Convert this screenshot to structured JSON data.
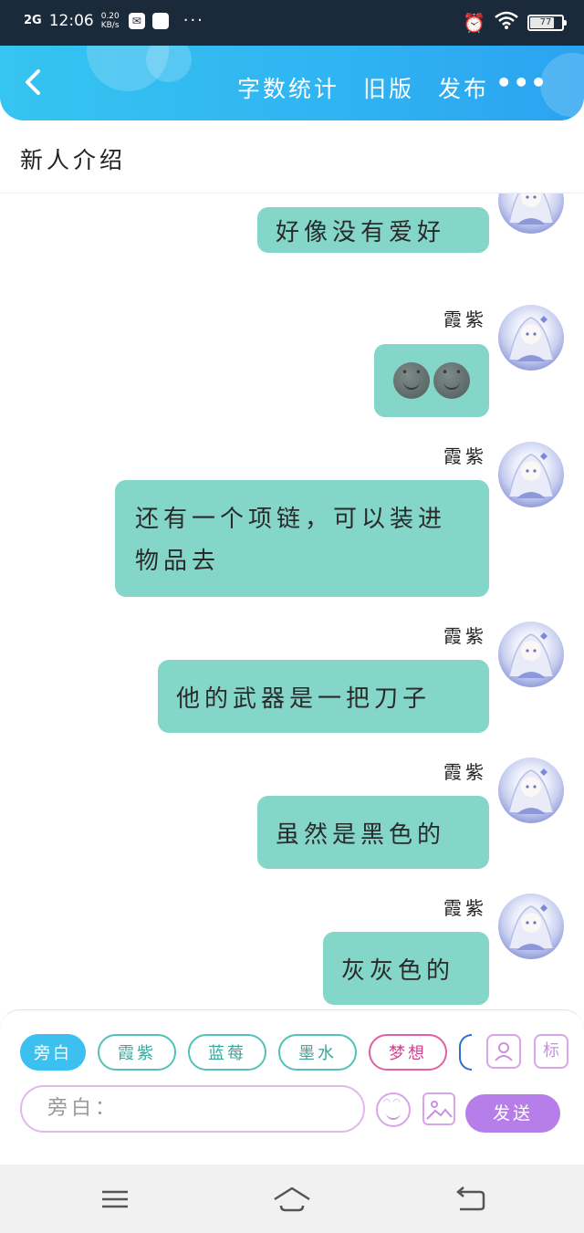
{
  "status_bar": {
    "signal": "2G",
    "time": "12:06",
    "speed_value": "0.20",
    "speed_unit": "KB/s",
    "battery": "77",
    "battery_level": 0.77
  },
  "header": {
    "back_icon": "chevron-left-icon",
    "actions": [
      "字数统计",
      "旧版",
      "发布"
    ],
    "more_label": "•••"
  },
  "page_title": "新人介绍",
  "messages": [
    {
      "sender": "",
      "text": "好像没有爱好"
    },
    {
      "sender": "霞紫",
      "text": "",
      "emoji_count": 2
    },
    {
      "sender": "霞紫",
      "text": "还有一个项链，可以装进物品去"
    },
    {
      "sender": "霞紫",
      "text": "他的武器是一把刀子"
    },
    {
      "sender": "霞紫",
      "text": "虽然是黑色的"
    },
    {
      "sender": "霞紫",
      "text": "灰灰色的"
    }
  ],
  "roles": [
    "旁白",
    "霞紫",
    "蓝莓",
    "墨水",
    "梦想"
  ],
  "tools": {
    "character_icon": "person-card-icon",
    "tag_label": "标"
  },
  "input": {
    "placeholder": "旁白："
  },
  "send_label": "发送",
  "colors": {
    "header": "#2fb3f2",
    "bubble": "#84d6c9",
    "send": "#b57ee8",
    "active_role": "#3cc0f0"
  }
}
